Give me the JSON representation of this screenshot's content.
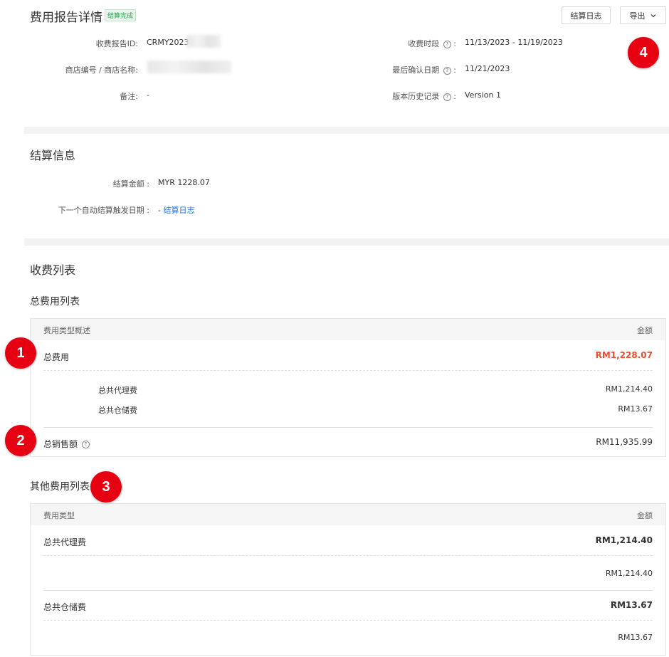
{
  "header": {
    "title": "费用报告详情",
    "status_badge": "结算完成",
    "log_button": "结算日志",
    "export_button": "导出"
  },
  "details": {
    "report_id_label": "收费报告ID:",
    "report_id_value": "CRMY20231",
    "store_label": "商店编号 / 商店名称:",
    "note_label": "备注:",
    "note_value": "-",
    "period_label": "收费时段",
    "period_value": "11/13/2023 - 11/19/2023",
    "confirm_label": "最后确认日期",
    "confirm_value": "11/21/2023",
    "version_label": "版本历史记录",
    "version_value": "Version 1",
    "colon": ":"
  },
  "settlement": {
    "title": "结算信息",
    "amount_label": "结算金额 :",
    "amount_value": "MYR 1228.07",
    "next_label": "下一个自动结算触发日期 :",
    "next_dash": "- ",
    "next_link": "结算日志"
  },
  "fees": {
    "title": "收费列表",
    "total_title": "总费用列表",
    "total_table": {
      "col_type": "费用类型概述",
      "col_amount": "金额",
      "total_fee_label": "总费用",
      "total_fee_value": "RM1,228.07",
      "sub_rows": [
        {
          "label": "总共代理费",
          "value": "RM1,214.40"
        },
        {
          "label": "总共仓储费",
          "value": "RM13.67"
        }
      ],
      "sales_label": "总销售额",
      "sales_value": "RM11,935.99"
    },
    "other_title": "其他费用列表",
    "other_table": {
      "col_type": "费用类型",
      "col_amount": "金额",
      "rows": [
        {
          "label": "总共代理费",
          "value": "RM1,214.40",
          "sub_value": "RM1,214.40"
        },
        {
          "label": "总共仓储费",
          "value": "RM13.67",
          "sub_value": "RM13.67"
        }
      ]
    }
  },
  "markers": [
    "1",
    "2",
    "3",
    "4"
  ],
  "colors": {
    "accent_red": "#ee4d2d",
    "marker_red": "#e60012",
    "link_blue": "#2673dd",
    "badge_green": "#2e9e4f"
  }
}
